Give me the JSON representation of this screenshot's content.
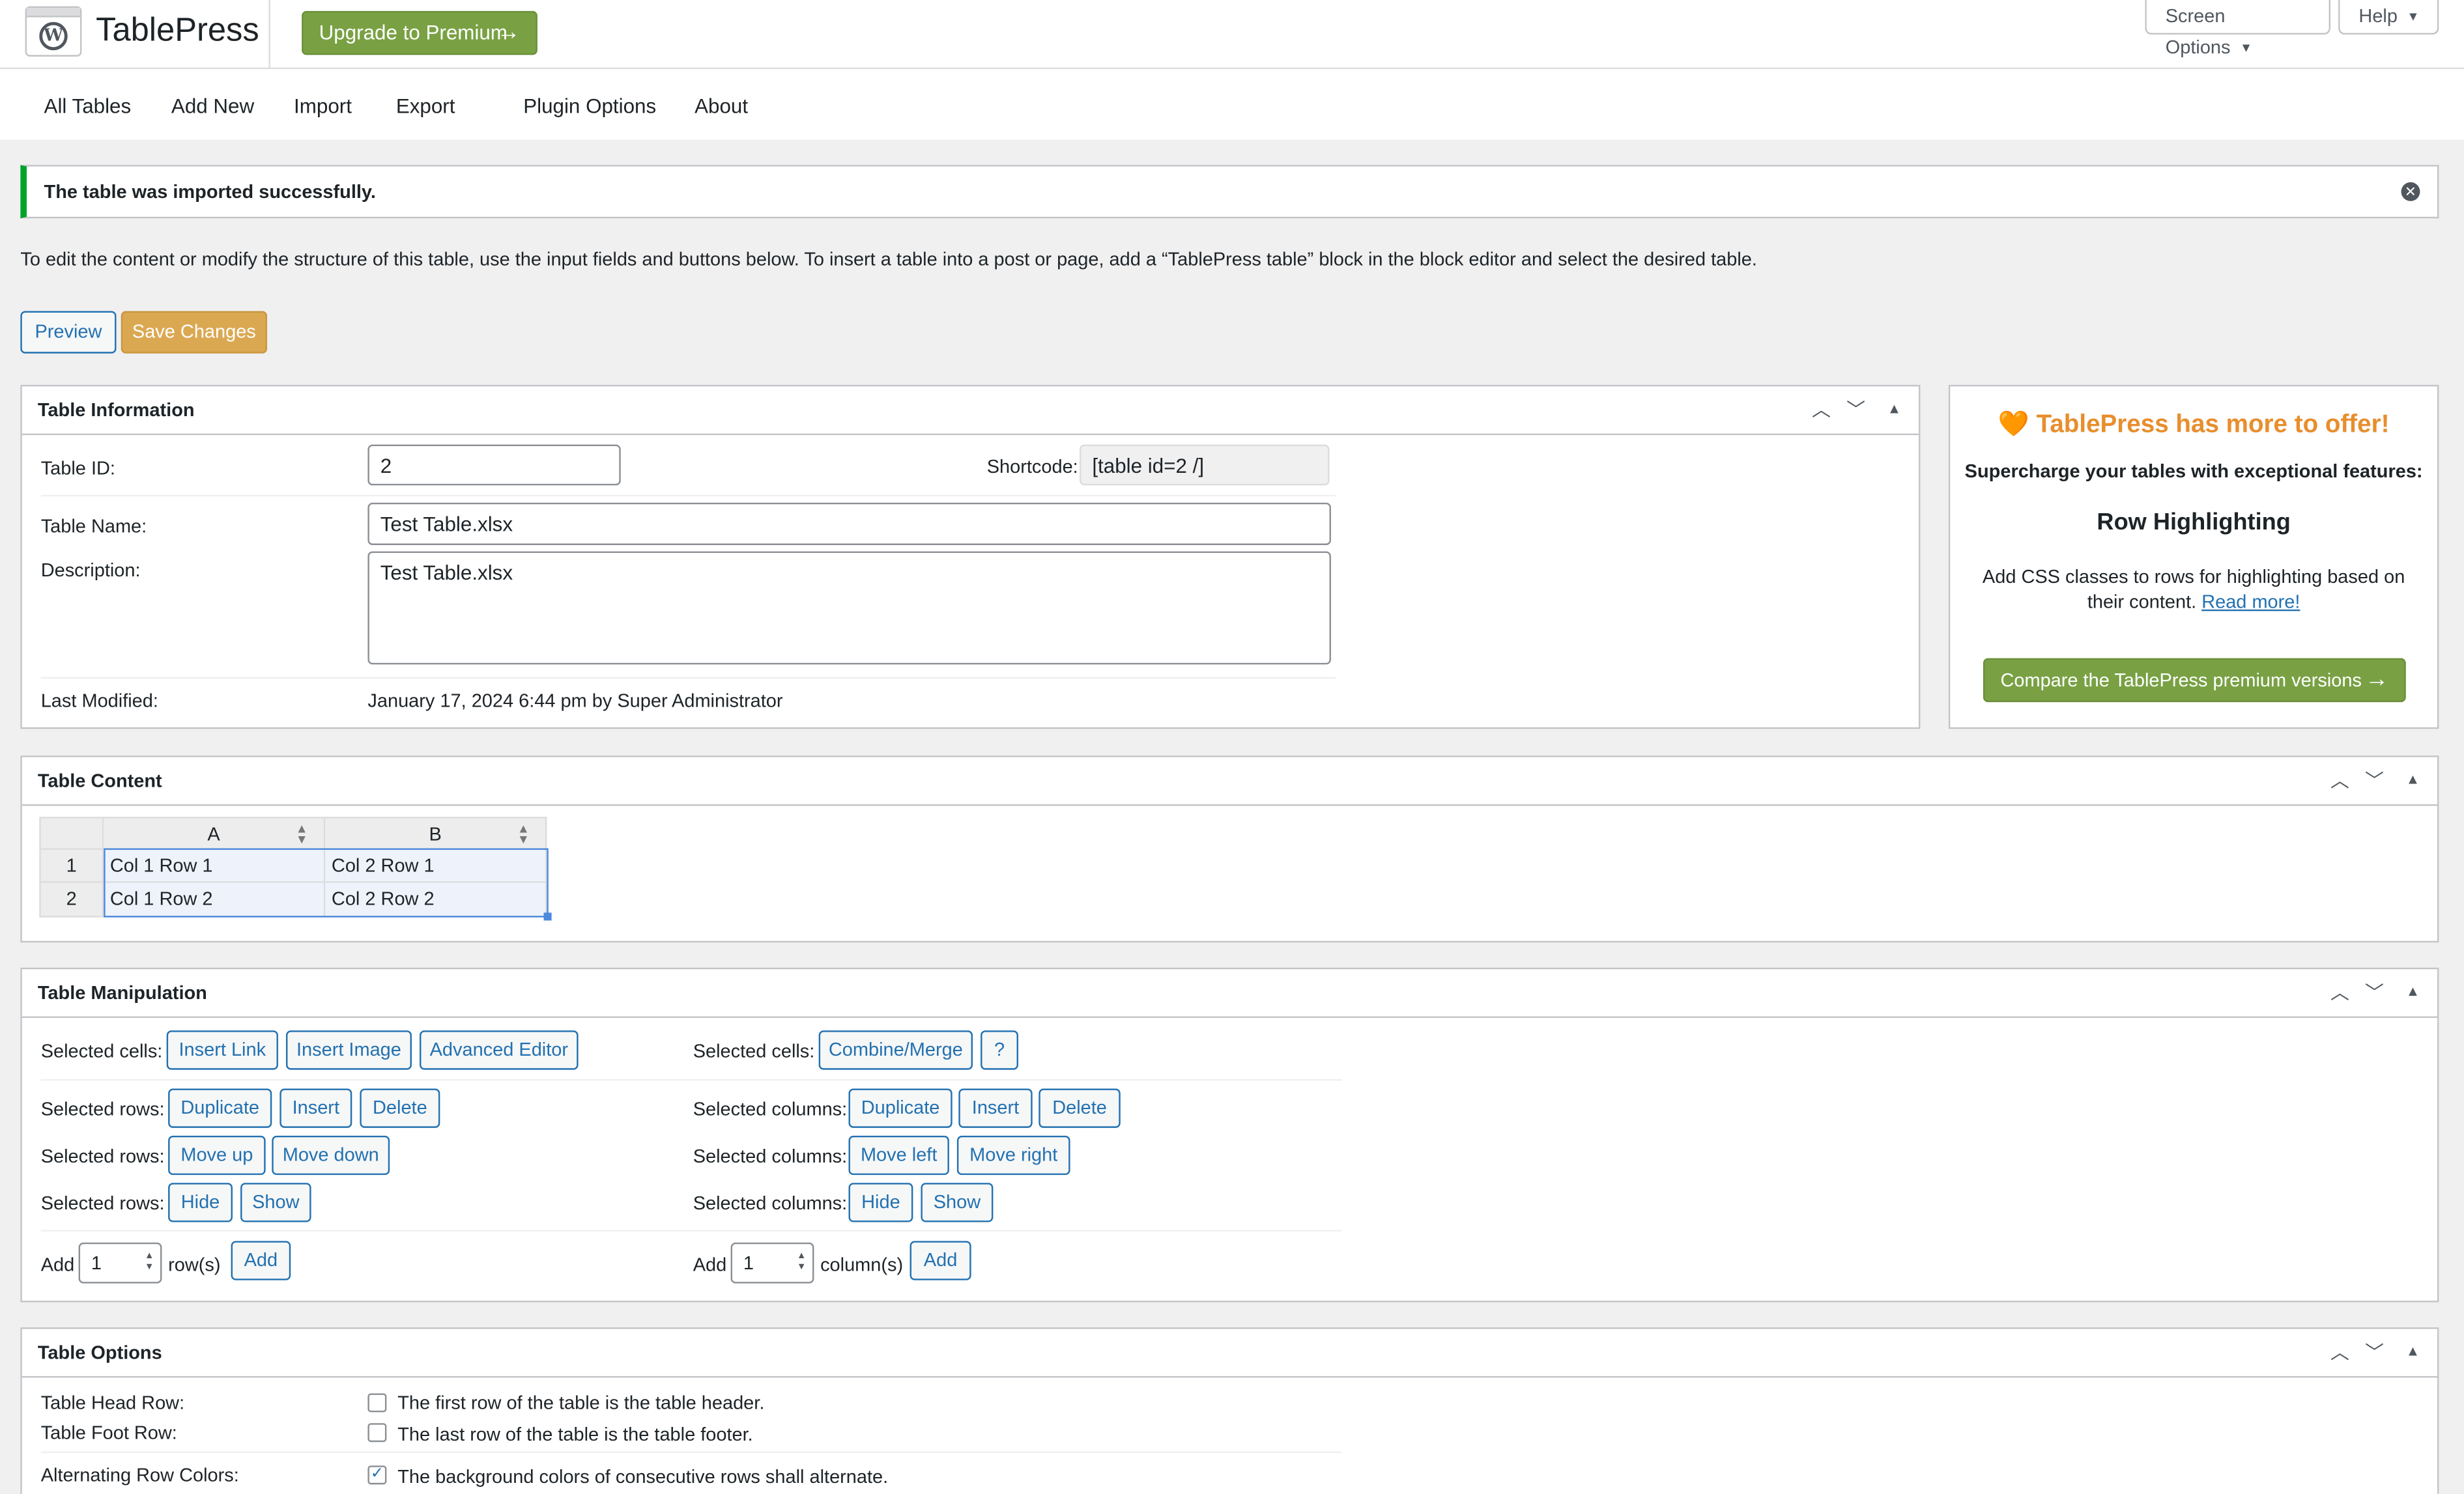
{
  "header": {
    "brand": "TablePress",
    "upgrade_label": "Upgrade to Premium",
    "screen_options": "Screen Options",
    "help": "Help"
  },
  "nav": {
    "items": [
      "All Tables",
      "Add New",
      "Import",
      "Export",
      "Plugin Options",
      "About"
    ]
  },
  "notice": {
    "text": "The table was imported successfully."
  },
  "intro": "To edit the content or modify the structure of this table, use the input fields and buttons below. To insert a table into a post or page, add a “TablePress table” block in the block editor and select the desired table.",
  "actions": {
    "preview": "Preview",
    "save": "Save Changes"
  },
  "table_info": {
    "title": "Table Information",
    "id_label": "Table ID:",
    "id_value": "2",
    "shortcode_label": "Shortcode:",
    "shortcode_value": "[table id=2 /]",
    "name_label": "Table Name:",
    "name_value": "Test Table.xlsx",
    "desc_label": "Description:",
    "desc_value": "Test Table.xlsx",
    "modified_label": "Last Modified:",
    "modified_value": "January 17, 2024 6:44 pm by Super Administrator"
  },
  "promo": {
    "title": "TablePress has more to offer!",
    "subtitle": "Supercharge your tables with exceptional features:",
    "feature": "Row Highlighting",
    "desc": "Add CSS classes to rows for highlighting based on their content.",
    "read_more": "Read more!",
    "compare": "Compare the TablePress premium versions"
  },
  "table_content": {
    "title": "Table Content",
    "columns": [
      "A",
      "B"
    ],
    "rows": [
      {
        "num": "1",
        "cells": [
          "Col 1 Row 1",
          "Col 2 Row 1"
        ]
      },
      {
        "num": "2",
        "cells": [
          "Col 1 Row 2",
          "Col 2 Row 2"
        ]
      }
    ]
  },
  "manipulation": {
    "title": "Table Manipulation",
    "selected_cells": "Selected cells:",
    "selected_rows": "Selected rows:",
    "selected_columns": "Selected columns:",
    "insert_link": "Insert Link",
    "insert_image": "Insert Image",
    "advanced_editor": "Advanced Editor",
    "combine_merge": "Combine/Merge",
    "help": "?",
    "duplicate": "Duplicate",
    "insert": "Insert",
    "delete": "Delete",
    "move_up": "Move up",
    "move_down": "Move down",
    "move_left": "Move left",
    "move_right": "Move right",
    "hide": "Hide",
    "show": "Show",
    "add": "Add",
    "add_rows_value": "1",
    "rows_suffix": "row(s)",
    "add_cols_value": "1",
    "cols_suffix": "column(s)"
  },
  "options": {
    "title": "Table Options",
    "head_label": "Table Head Row:",
    "head_text": "The first row of the table is the table header.",
    "foot_label": "Table Foot Row:",
    "foot_text": "The last row of the table is the table footer.",
    "alt_label": "Alternating Row Colors:",
    "alt_text": "The background colors of consecutive rows shall alternate."
  }
}
